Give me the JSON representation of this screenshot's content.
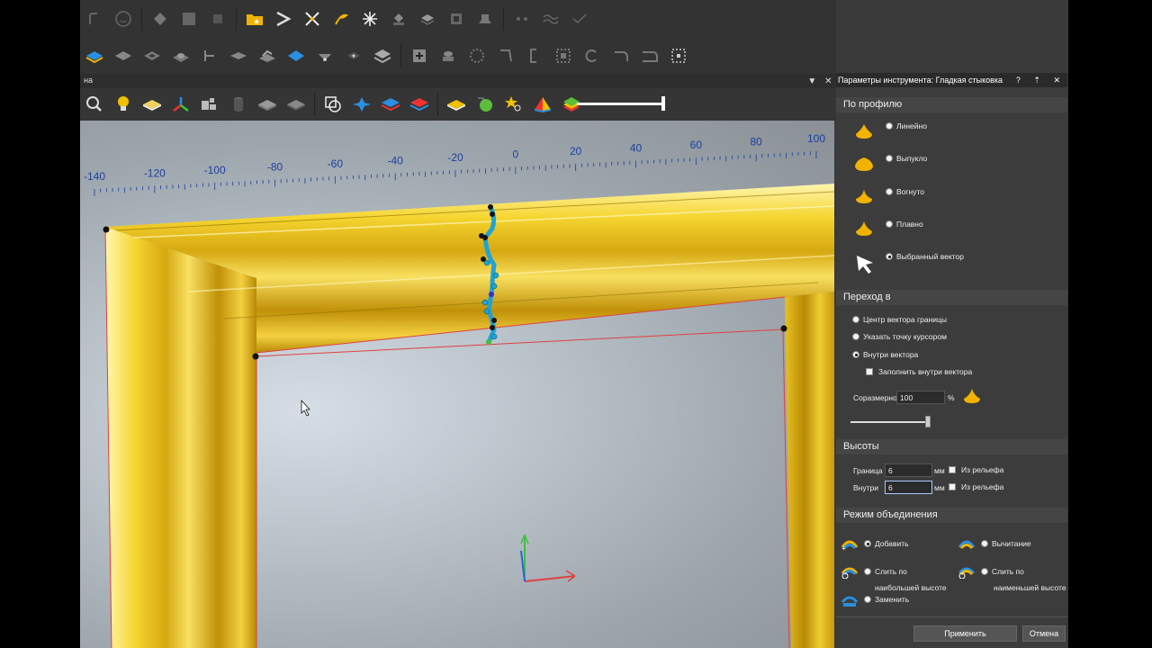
{
  "viewport": {
    "tab_label": "на",
    "ruler_labels": [
      "-140",
      "-120",
      "-100",
      "-80",
      "-60",
      "-40",
      "-20",
      "0",
      "20",
      "40",
      "60",
      "80",
      "100"
    ]
  },
  "panel": {
    "title": "Параметры инструмента: Гладкая стыковка",
    "title_controls": "? ⇡ ✕",
    "profile_section": "По профилю",
    "profile_options": [
      "Линейно",
      "Выпукло",
      "Вогнуто",
      "Плавно",
      "Выбранный вектор"
    ],
    "profile_selected": "Выбранный вектор",
    "transition_section": "Переход в",
    "transition_options": [
      "Центр вектора границы",
      "Указать точку курсором",
      "Внутри вектора"
    ],
    "transition_selected": "Внутри вектора",
    "fill_inside_label": "Заполнить внутри вектора",
    "proportional_label": "Соразмерно",
    "proportional_value": "100",
    "percent_sign": "%",
    "proportional_slider": 0.98,
    "heights_section": "Высоты",
    "border_label": "Граница",
    "border_value": "6",
    "inside_label": "Внутри",
    "inside_value": "6",
    "unit": "мм",
    "from_relief_label": "Из рельефа",
    "merge_section": "Режим объединения",
    "merge_add": "Добавить",
    "merge_subtract": "Вычитание",
    "merge_highest_line1": "Слить по",
    "merge_highest_line2": "наибольшей высоте",
    "merge_lowest_line1": "Слить по",
    "merge_lowest_line2": "наименьшей высоте",
    "merge_replace": "Заменить",
    "merge_selected": "Добавить",
    "apply_button": "Применить",
    "cancel_button": "Отмена"
  },
  "colors": {
    "frame_gold": "#e8c21a",
    "selection_blue": "#1fa3d8",
    "boundary_red": "#e04040"
  }
}
